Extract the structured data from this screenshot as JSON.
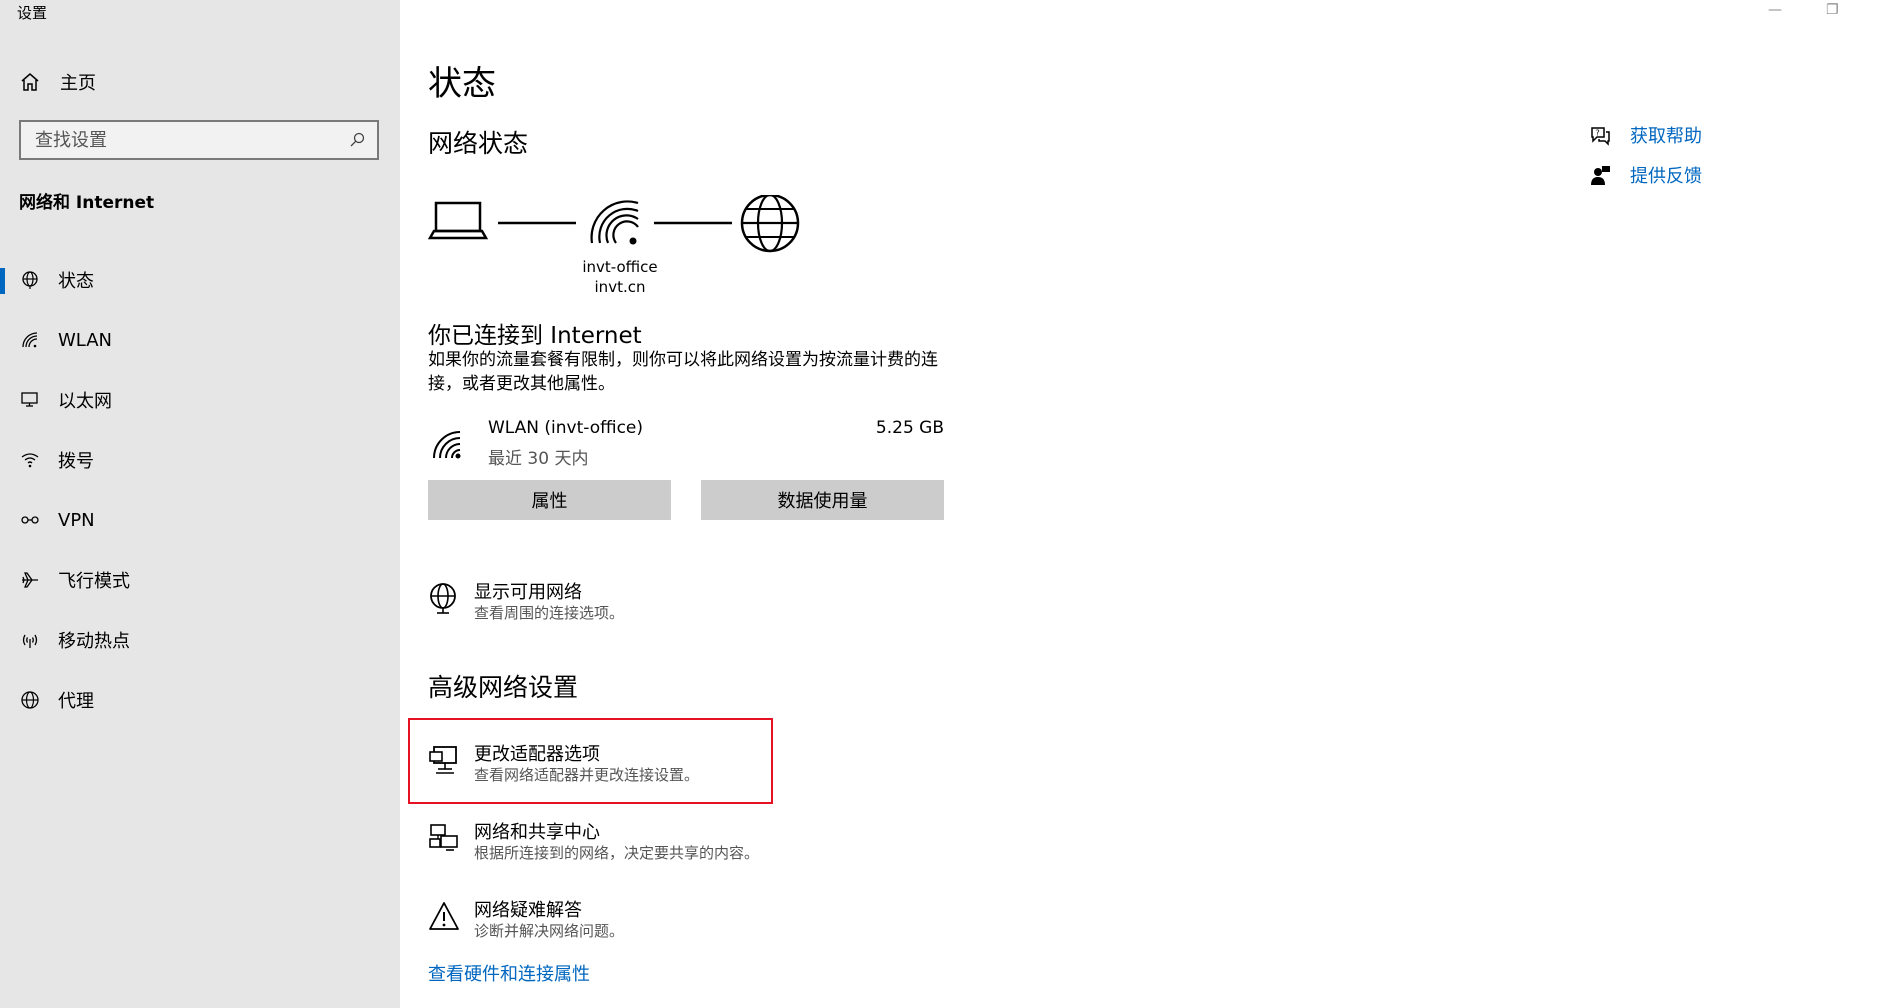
{
  "window": {
    "title": "设置",
    "minimize_glyph": "—",
    "restore_glyph": "❐"
  },
  "sidebar": {
    "home_label": "主页",
    "search_placeholder": "查找设置",
    "section_title": "网络和 Internet",
    "items": [
      {
        "label": "状态",
        "icon": "globe-network-icon",
        "active": true
      },
      {
        "label": "WLAN",
        "icon": "wifi-icon",
        "active": false
      },
      {
        "label": "以太网",
        "icon": "ethernet-icon",
        "active": false
      },
      {
        "label": "拨号",
        "icon": "dialup-icon",
        "active": false
      },
      {
        "label": "VPN",
        "icon": "vpn-icon",
        "active": false
      },
      {
        "label": "飞行模式",
        "icon": "airplane-icon",
        "active": false
      },
      {
        "label": "移动热点",
        "icon": "hotspot-icon",
        "active": false
      },
      {
        "label": "代理",
        "icon": "globe-icon",
        "active": false
      }
    ]
  },
  "main": {
    "title": "状态",
    "network_status_heading": "网络状态",
    "network_name": "invt-office",
    "network_domain": "invt.cn",
    "connected_title": "你已连接到 Internet",
    "connected_desc": "如果你的流量套餐有限制，则你可以将此网络设置为按流量计费的连接，或者更改其他属性。",
    "wlan": {
      "name": "WLAN (invt-office)",
      "period": "最近 30 天内",
      "usage": "5.25 GB"
    },
    "buttons": {
      "properties": "属性",
      "data_usage": "数据使用量"
    },
    "show_networks": {
      "title": "显示可用网络",
      "desc": "查看周围的连接选项。"
    },
    "advanced_heading": "高级网络设置",
    "advanced_items": [
      {
        "title": "更改适配器选项",
        "desc": "查看网络适配器并更改连接设置。"
      },
      {
        "title": "网络和共享中心",
        "desc": "根据所连接到的网络，决定要共享的内容。"
      },
      {
        "title": "网络疑难解答",
        "desc": "诊断并解决网络问题。"
      }
    ],
    "hardware_link": "查看硬件和连接属性"
  },
  "right": {
    "help": "获取帮助",
    "feedback": "提供反馈"
  },
  "colors": {
    "accent": "#0067c0",
    "highlight": "#e81123",
    "sidebar_bg": "#e6e6e6"
  }
}
